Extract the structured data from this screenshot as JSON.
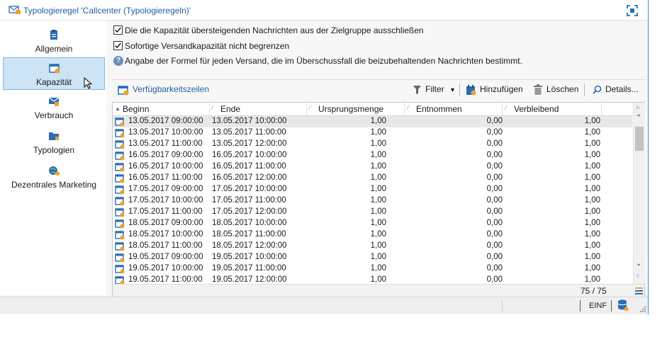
{
  "window": {
    "title": "Typologieregel 'Callcenter (Typologieregeln)'"
  },
  "icons": {
    "window": "envelope-rule-icon",
    "fullscreen": "fullscreen-icon"
  },
  "sidebar": {
    "items": [
      {
        "label": "Allgemein",
        "icon": "clipboard-icon"
      },
      {
        "label": "Kapazität",
        "icon": "calendar-gear-icon",
        "active": true
      },
      {
        "label": "Verbrauch",
        "icon": "envelope-stack-icon"
      },
      {
        "label": "Typologien",
        "icon": "folder-icon"
      },
      {
        "label": "Dezentrales Marketing",
        "icon": "globe-user-icon"
      }
    ]
  },
  "options": {
    "exclude_label": "Die die Kapazität übersteigenden Nachrichten aus der Zielgruppe ausschließen",
    "exclude_checked": true,
    "unlimited_label": "Sofortige Versandkapazität nicht begrenzen",
    "unlimited_checked": true,
    "formula_label": "Angabe der Formel für jeden Versand, die im Überschussfall die beizubehaltenden Nachrichten bestimmt."
  },
  "toolbar": {
    "availability": "Verfügbarkeitszeilen",
    "filter": "Filter",
    "add": "Hinzufügen",
    "delete": "Löschen",
    "details": "Details..."
  },
  "table": {
    "columns": [
      "Beginn",
      "Ende",
      "Ursprungsmenge",
      "Entnommen",
      "Verbleibend"
    ],
    "rows": [
      [
        "13.05.2017 09:00:00",
        "13.05.2017 10:00:00",
        "1,00",
        "0,00",
        "1,00"
      ],
      [
        "13.05.2017 10:00:00",
        "13.05.2017 11:00:00",
        "1,00",
        "0,00",
        "1,00"
      ],
      [
        "13.05.2017 11:00:00",
        "13.05.2017 12:00:00",
        "1,00",
        "0,00",
        "1,00"
      ],
      [
        "16.05.2017 09:00:00",
        "16.05.2017 10:00:00",
        "1,00",
        "0,00",
        "1,00"
      ],
      [
        "16.05.2017 10:00:00",
        "16.05.2017 11:00:00",
        "1,00",
        "0,00",
        "1,00"
      ],
      [
        "16.05.2017 11:00:00",
        "16.05.2017 12:00:00",
        "1,00",
        "0,00",
        "1,00"
      ],
      [
        "17.05.2017 09:00:00",
        "17.05.2017 10:00:00",
        "1,00",
        "0,00",
        "1,00"
      ],
      [
        "17.05.2017 10:00:00",
        "17.05.2017 11:00:00",
        "1,00",
        "0,00",
        "1,00"
      ],
      [
        "17.05.2017 11:00:00",
        "17.05.2017 12:00:00",
        "1,00",
        "0,00",
        "1,00"
      ],
      [
        "18.05.2017 09:00:00",
        "18.05.2017 10:00:00",
        "1,00",
        "0,00",
        "1,00"
      ],
      [
        "18.05.2017 10:00:00",
        "18.05.2017 11:00:00",
        "1,00",
        "0,00",
        "1,00"
      ],
      [
        "18.05.2017 11:00:00",
        "18.05.2017 12:00:00",
        "1,00",
        "0,00",
        "1,00"
      ],
      [
        "19.05.2017 09:00:00",
        "19.05.2017 10:00:00",
        "1,00",
        "0,00",
        "1,00"
      ],
      [
        "19.05.2017 10:00:00",
        "19.05.2017 11:00:00",
        "1,00",
        "0,00",
        "1,00"
      ],
      [
        "19.05.2017 11:00:00",
        "19.05.2017 12:00:00",
        "1,00",
        "0,00",
        "1,00"
      ]
    ],
    "count": "75 / 75"
  },
  "status": {
    "mode": "EINF"
  }
}
